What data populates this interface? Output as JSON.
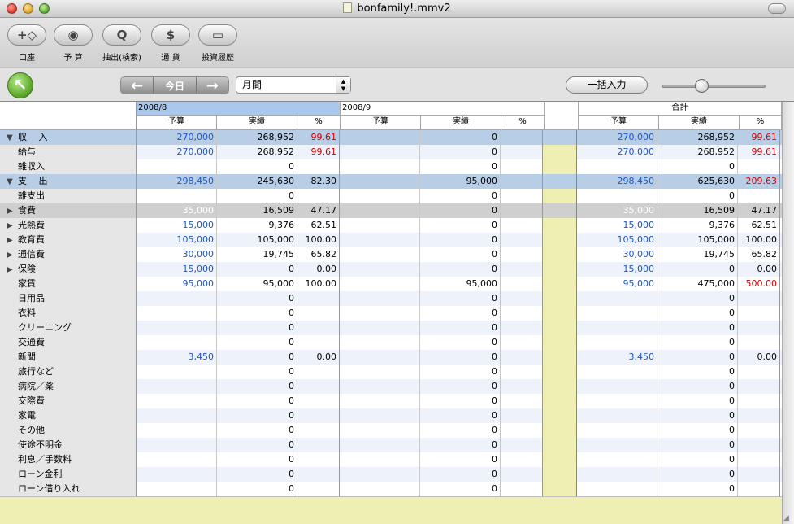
{
  "window": {
    "title": "bonfamily!.mmv2"
  },
  "toolbar": {
    "items": [
      {
        "label": "口座",
        "icon": "account-icon",
        "glyph": "+◇"
      },
      {
        "label": "予 算",
        "icon": "eye-icon",
        "glyph": "◉"
      },
      {
        "label": "抽出(検索)",
        "icon": "search-icon",
        "glyph": "Q"
      },
      {
        "label": "通 貨",
        "icon": "dollar-icon",
        "glyph": "$"
      },
      {
        "label": "投資履歴",
        "icon": "folder-icon",
        "glyph": "▭"
      }
    ]
  },
  "nav": {
    "today_label": "今日",
    "prev_glyph": "←",
    "next_glyph": "→",
    "period_value": "月間",
    "bulk_label": "一括入力"
  },
  "grid": {
    "months": [
      "2008/8",
      "2008/9"
    ],
    "total_label": "合計",
    "col_headers": {
      "budget": "予算",
      "actual": "実績",
      "pct": "%"
    },
    "rows": [
      {
        "kind": "group",
        "expander": "▼",
        "label": "収　 入",
        "m1": [
          "270,000",
          "268,952",
          "99.61"
        ],
        "m2": [
          "",
          "0",
          ""
        ],
        "tot": [
          "270,000",
          "268,952",
          "99.61"
        ],
        "m1pctRed": true,
        "totPctRed": true
      },
      {
        "kind": "item",
        "expander": "",
        "label": "給与",
        "m1": [
          "270,000",
          "268,952",
          "99.61"
        ],
        "m2": [
          "",
          "0",
          ""
        ],
        "tot": [
          "270,000",
          "268,952",
          "99.61"
        ],
        "m1pctRed": true,
        "totPctRed": true
      },
      {
        "kind": "item",
        "expander": "",
        "label": "雑収入",
        "m1": [
          "",
          "0",
          ""
        ],
        "m2": [
          "",
          "0",
          ""
        ],
        "tot": [
          "",
          "0",
          ""
        ]
      },
      {
        "kind": "group",
        "expander": "▼",
        "label": "支　 出",
        "m1": [
          "298,450",
          "245,630",
          "82.30"
        ],
        "m2": [
          "",
          "95,000",
          ""
        ],
        "tot": [
          "298,450",
          "625,630",
          "209.63"
        ],
        "totPctRed": true
      },
      {
        "kind": "item",
        "expander": "",
        "label": "雑支出",
        "m1": [
          "",
          "0",
          ""
        ],
        "m2": [
          "",
          "0",
          ""
        ],
        "tot": [
          "",
          "0",
          ""
        ]
      },
      {
        "kind": "gray",
        "expander": "▶",
        "label": "食費",
        "m1": [
          "35,000",
          "16,509",
          "47.17"
        ],
        "m2": [
          "",
          "0",
          ""
        ],
        "tot": [
          "35,000",
          "16,509",
          "47.17"
        ]
      },
      {
        "kind": "item",
        "expander": "▶",
        "label": "光熱費",
        "m1": [
          "15,000",
          "9,376",
          "62.51"
        ],
        "m2": [
          "",
          "0",
          ""
        ],
        "tot": [
          "15,000",
          "9,376",
          "62.51"
        ]
      },
      {
        "kind": "item",
        "expander": "▶",
        "label": "教育費",
        "m1": [
          "105,000",
          "105,000",
          "100.00"
        ],
        "m2": [
          "",
          "0",
          ""
        ],
        "tot": [
          "105,000",
          "105,000",
          "100.00"
        ]
      },
      {
        "kind": "item",
        "expander": "▶",
        "label": "通信費",
        "m1": [
          "30,000",
          "19,745",
          "65.82"
        ],
        "m2": [
          "",
          "0",
          ""
        ],
        "tot": [
          "30,000",
          "19,745",
          "65.82"
        ]
      },
      {
        "kind": "item",
        "expander": "▶",
        "label": "保険",
        "m1": [
          "15,000",
          "0",
          "0.00"
        ],
        "m2": [
          "",
          "0",
          ""
        ],
        "tot": [
          "15,000",
          "0",
          "0.00"
        ]
      },
      {
        "kind": "item",
        "expander": "",
        "label": "家賃",
        "m1": [
          "95,000",
          "95,000",
          "100.00"
        ],
        "m2": [
          "",
          "95,000",
          ""
        ],
        "tot": [
          "95,000",
          "475,000",
          "500.00"
        ],
        "totPctRed": true
      },
      {
        "kind": "item",
        "expander": "",
        "label": "日用品",
        "m1": [
          "",
          "0",
          ""
        ],
        "m2": [
          "",
          "0",
          ""
        ],
        "tot": [
          "",
          "0",
          ""
        ]
      },
      {
        "kind": "item",
        "expander": "",
        "label": "衣料",
        "m1": [
          "",
          "0",
          ""
        ],
        "m2": [
          "",
          "0",
          ""
        ],
        "tot": [
          "",
          "0",
          ""
        ]
      },
      {
        "kind": "item",
        "expander": "",
        "label": "クリーニング",
        "m1": [
          "",
          "0",
          ""
        ],
        "m2": [
          "",
          "0",
          ""
        ],
        "tot": [
          "",
          "0",
          ""
        ]
      },
      {
        "kind": "item",
        "expander": "",
        "label": "交通費",
        "m1": [
          "",
          "0",
          ""
        ],
        "m2": [
          "",
          "0",
          ""
        ],
        "tot": [
          "",
          "0",
          ""
        ]
      },
      {
        "kind": "item",
        "expander": "",
        "label": "新聞",
        "m1": [
          "3,450",
          "0",
          "0.00"
        ],
        "m2": [
          "",
          "0",
          ""
        ],
        "tot": [
          "3,450",
          "0",
          "0.00"
        ]
      },
      {
        "kind": "item",
        "expander": "",
        "label": "旅行など",
        "m1": [
          "",
          "0",
          ""
        ],
        "m2": [
          "",
          "0",
          ""
        ],
        "tot": [
          "",
          "0",
          ""
        ]
      },
      {
        "kind": "item",
        "expander": "",
        "label": "病院／薬",
        "m1": [
          "",
          "0",
          ""
        ],
        "m2": [
          "",
          "0",
          ""
        ],
        "tot": [
          "",
          "0",
          ""
        ]
      },
      {
        "kind": "item",
        "expander": "",
        "label": "交際費",
        "m1": [
          "",
          "0",
          ""
        ],
        "m2": [
          "",
          "0",
          ""
        ],
        "tot": [
          "",
          "0",
          ""
        ]
      },
      {
        "kind": "item",
        "expander": "",
        "label": "家電",
        "m1": [
          "",
          "0",
          ""
        ],
        "m2": [
          "",
          "0",
          ""
        ],
        "tot": [
          "",
          "0",
          ""
        ]
      },
      {
        "kind": "item",
        "expander": "",
        "label": "その他",
        "m1": [
          "",
          "0",
          ""
        ],
        "m2": [
          "",
          "0",
          ""
        ],
        "tot": [
          "",
          "0",
          ""
        ]
      },
      {
        "kind": "item",
        "expander": "",
        "label": "使途不明金",
        "m1": [
          "",
          "0",
          ""
        ],
        "m2": [
          "",
          "0",
          ""
        ],
        "tot": [
          "",
          "0",
          ""
        ]
      },
      {
        "kind": "item",
        "expander": "",
        "label": "利息／手数料",
        "m1": [
          "",
          "0",
          ""
        ],
        "m2": [
          "",
          "0",
          ""
        ],
        "tot": [
          "",
          "0",
          ""
        ]
      },
      {
        "kind": "item",
        "expander": "",
        "label": "ローン金利",
        "m1": [
          "",
          "0",
          ""
        ],
        "m2": [
          "",
          "0",
          ""
        ],
        "tot": [
          "",
          "0",
          ""
        ]
      },
      {
        "kind": "item",
        "expander": "",
        "label": "ローン借り入れ",
        "m1": [
          "",
          "0",
          ""
        ],
        "m2": [
          "",
          "0",
          ""
        ],
        "tot": [
          "",
          "0",
          ""
        ]
      }
    ]
  },
  "colors": {
    "budget": "#1f56c2",
    "over": "#d10000",
    "group_row": "#b8cde6",
    "selected_month": "#a9c8ec",
    "gap_column": "#efefb4"
  }
}
